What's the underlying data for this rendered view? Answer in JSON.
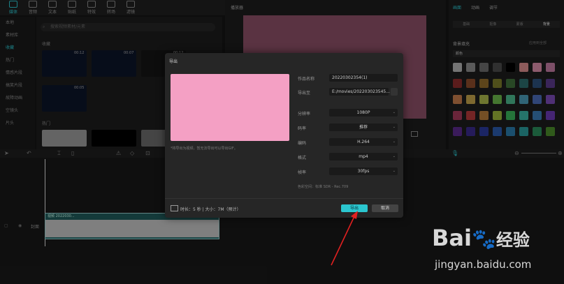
{
  "toolbar": {
    "tools": [
      {
        "label": "媒体",
        "active": true
      },
      {
        "label": "音频"
      },
      {
        "label": "文本"
      },
      {
        "label": "贴纸"
      },
      {
        "label": "特效"
      },
      {
        "label": "转场"
      },
      {
        "label": "滤镜"
      }
    ]
  },
  "left_nav": {
    "items": [
      "本地",
      "素材库",
      "收藏",
      "热门",
      "情感片段",
      "搞笑片段",
      "故障动画",
      "空镜头",
      "片头"
    ]
  },
  "media": {
    "search_placeholder": "搜索视频素材/元素",
    "section_label": "收藏",
    "section_label2": "热门",
    "thumb_durations": [
      "00:12",
      "00:07",
      "00:12",
      "00:05"
    ]
  },
  "player": {
    "title": "播放器"
  },
  "inspector": {
    "tabs": [
      "画面",
      "动画",
      "调节"
    ],
    "subtabs": [
      "基础",
      "抠像",
      "蒙版",
      "背景"
    ],
    "section": "背景填充",
    "apply_all": "应用到全部",
    "color_label": "颜色",
    "swatch_colors": [
      "#b3b3b3",
      "#8a8a8a",
      "#6a6a6a",
      "#4a4a4a",
      "#000000",
      "#d98d8d",
      "#d98da8",
      "#c07aa0",
      "#8c2b2b",
      "#8a4a2a",
      "#8f6a2a",
      "#7a7a2a",
      "#3e6e3a",
      "#2c6a6a",
      "#2c4f7a",
      "#5a3a8a",
      "#c27a4a",
      "#c2a24a",
      "#aab54a",
      "#6ab54a",
      "#4ab58a",
      "#4a9ab5",
      "#4a6ab5",
      "#7a4ab5",
      "#a33a5a",
      "#b33a3a",
      "#b37a3a",
      "#9ab33a",
      "#3ab35a",
      "#3ab3a3",
      "#3a7ab3",
      "#6a3ab3",
      "#5a2a8a",
      "#3a2a8a",
      "#2a3a9a",
      "#2a5aaa",
      "#2a7aaa",
      "#2a9a9a",
      "#2a8a5a",
      "#4a8a2a"
    ]
  },
  "timeline": {
    "track_label": "封面",
    "clip_label": "视频  2022030..."
  },
  "dialog": {
    "title": "导出",
    "hint": "*将导出为视频，暂无法导出可以导出GIF。",
    "fields": [
      {
        "label": "作品名称",
        "value": "20220302354(1)"
      },
      {
        "label": "导出至",
        "value": "E:/movies/202203023545..."
      }
    ],
    "selects": [
      {
        "label": "分辨率",
        "value": "1080P"
      },
      {
        "label": "码率",
        "value": "推荐"
      },
      {
        "label": "编码",
        "value": "H.264"
      },
      {
        "label": "格式",
        "value": "mp4"
      },
      {
        "label": "帧率",
        "value": "30fps"
      }
    ],
    "color_space": "色彩空间：标准 SDR - Rec.709",
    "footer_info": "时长：5 秒  |  大小：7M（预计）",
    "export_label": "导出",
    "cancel_label": "取消"
  },
  "watermark": {
    "brand": "Bai",
    "brand2": "经验",
    "url": "jingyan.baidu.com"
  }
}
